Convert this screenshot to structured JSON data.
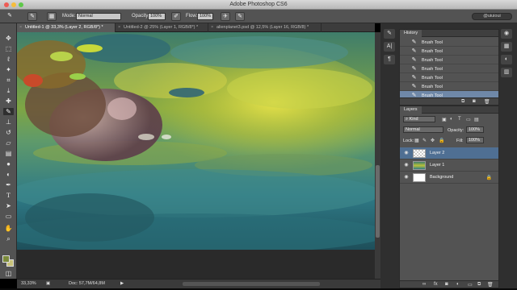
{
  "app": {
    "title": "Adobe Photoshop CS6"
  },
  "options": {
    "mode_label": "Mode:",
    "mode_value": "Normal",
    "opacity_label": "Opacity:",
    "opacity_value": "100%",
    "flow_label": "Flow:",
    "flow_value": "100%",
    "workspace": "@uiuioui"
  },
  "tabs": [
    {
      "label": "Untitled-1 @ 33,3% (Layer 2, RGB/8*) *",
      "active": true
    },
    {
      "label": "Untitled-2 @ 25% (Layer 1, RGB/8*) *",
      "active": false
    },
    {
      "label": "alienplanet3.psd @ 12,5% (Layer 16, RGB/8) *",
      "active": false
    }
  ],
  "status": {
    "zoom": "33,33%",
    "doc": "Doc: 57,7M/64,8M"
  },
  "history": {
    "tab": "History",
    "items": [
      "Brush Tool",
      "Brush Tool",
      "Brush Tool",
      "Brush Tool",
      "Brush Tool",
      "Brush Tool",
      "Brush Tool"
    ]
  },
  "layers": {
    "tab": "Layers",
    "kind": "Kind",
    "blend": "Normal",
    "opacity_label": "Opacity:",
    "opacity_value": "100%",
    "lock_label": "Lock:",
    "fill_label": "Fill:",
    "fill_value": "100%",
    "items": [
      {
        "name": "Layer 2",
        "selected": true
      },
      {
        "name": "Layer 1",
        "selected": false
      },
      {
        "name": "Background",
        "selected": false
      }
    ]
  },
  "colors": {
    "foreground": "#7a8a3a",
    "background": "#c8c27a",
    "selection": "#6f88a8"
  },
  "icons": [
    "brush-icon",
    "move-icon",
    "marquee-icon",
    "lasso-icon",
    "quick-select-icon",
    "crop-icon",
    "eyedropper-icon",
    "healing-icon",
    "brush-tool-icon",
    "stamp-icon",
    "history-brush-icon",
    "eraser-icon",
    "gradient-icon",
    "blur-icon",
    "dodge-icon",
    "pen-icon",
    "type-icon",
    "path-select-icon",
    "shape-icon",
    "hand-icon",
    "zoom-icon"
  ]
}
